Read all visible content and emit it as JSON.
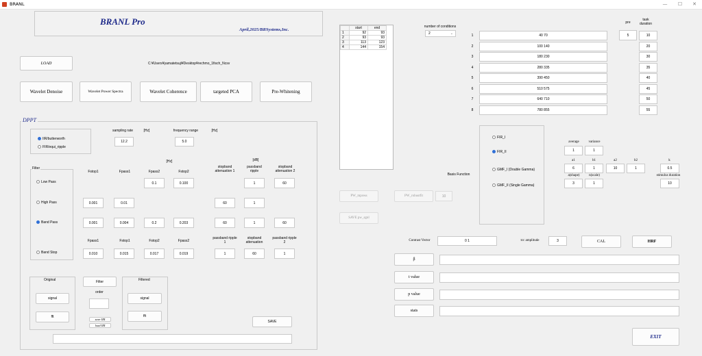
{
  "window": {
    "title": "BRANL",
    "controls": [
      "—",
      "☐",
      "✕"
    ]
  },
  "header": {
    "app_title": "BRANL Pro",
    "subtitle": "April,2025/BRSystems,Inc."
  },
  "load": {
    "label": "LOAD",
    "path": "C:¥Users¥yamatetsuji¥Desktop¥rechmo_1fisch_Ncsv"
  },
  "tools": [
    "Wavelet Denoise",
    "Wavelet Power Spectra",
    "Wavelet Coherence",
    "targeted PCA",
    "Pre-Whitening"
  ],
  "dppt": {
    "title": "DPPT",
    "filter_types": [
      "IIR/butterworth",
      "FIR/equi_ripple"
    ],
    "sampling_rate": {
      "label": "sampling rate",
      "value": "12.2",
      "unit": "[Hz]"
    },
    "frequency_range": {
      "label": "frequency range",
      "value": "5.0",
      "unit": "[Hz]"
    },
    "filter_group_label": "Filter",
    "filter_modes": [
      "Low Pass",
      "High Pass",
      "Band Pass",
      "Band Stop"
    ],
    "hz_unit": "[Hz]",
    "db_unit": "[dB]",
    "hdr1": [
      "Fstop1",
      "Fpass1",
      "Fpass2",
      "Fstop2",
      "stopband attenuation 1",
      "passband ripple",
      "stopband attenuation 2"
    ],
    "row_low": [
      "0.1",
      "0.100",
      "1",
      "60"
    ],
    "row_high": [
      "0.001",
      "0.01",
      "60",
      "1"
    ],
    "row_band": [
      "0.001",
      "0.004",
      "0.2",
      "0.203",
      "60",
      "1",
      "60"
    ],
    "hdr2": [
      "Fpass1",
      "Fstop1",
      "Fstop2",
      "Fpass2",
      "passband ripple 1",
      "stopband attenuation",
      "passband ripple 2"
    ],
    "row_stop": [
      "0.010",
      "0.015",
      "0.017",
      "0.019",
      "1",
      "60",
      "1"
    ],
    "original": {
      "label": "Original",
      "signal": "signal",
      "fft": "fft"
    },
    "filter_btn": "Filter",
    "order_label": "order",
    "order_value": "",
    "save_iir": "save IIR",
    "load_iir": "load IIR",
    "filtered": {
      "label": "Filtered",
      "signal": "signal",
      "fft": "fft"
    },
    "save": "SAVE",
    "status": ""
  },
  "intervals": {
    "headers": [
      "",
      "start",
      "end"
    ],
    "rows": [
      [
        "1",
        "92",
        "93"
      ],
      [
        "2",
        "93",
        "93"
      ],
      [
        "3",
        "113",
        "123"
      ],
      [
        "4",
        "144",
        "154"
      ]
    ]
  },
  "conditions": {
    "label": "number of conditions",
    "value": "2"
  },
  "cond_table": {
    "header_pre": "pre",
    "header_task": "task duration",
    "pre_value": "5",
    "rows": [
      {
        "n": "1",
        "onsets": "40 70",
        "task": "10"
      },
      {
        "n": "2",
        "onsets": "100 140",
        "task": "20"
      },
      {
        "n": "3",
        "onsets": "180 230",
        "task": "30"
      },
      {
        "n": "4",
        "onsets": "280 335",
        "task": "35"
      },
      {
        "n": "5",
        "onsets": "390 450",
        "task": "40"
      },
      {
        "n": "6",
        "onsets": "510 575",
        "task": "45"
      },
      {
        "n": "7",
        "onsets": "640 710",
        "task": "50"
      },
      {
        "n": "8",
        "onsets": "780 855",
        "task": "55"
      }
    ]
  },
  "basis": {
    "label": "Basis Function",
    "options": [
      "FIR_I",
      "FIR_II",
      "GMF_I (Double Gamma)",
      "GMF_II (Single Gamma)"
    ],
    "selected": 1
  },
  "params": {
    "average": {
      "label": "average",
      "value": "1"
    },
    "variance": {
      "label": "variance",
      "value": "1"
    },
    "a1": {
      "label": "a1",
      "value": "6"
    },
    "b1": {
      "label": "b1",
      "value": "1"
    },
    "a2": {
      "label": "a2",
      "value": "10"
    },
    "b2": {
      "label": "b2",
      "value": "1"
    },
    "k": {
      "label": "k",
      "value": "0.5"
    },
    "a_shape": {
      "label": "a(shape)",
      "value": "3"
    },
    "n_scale": {
      "label": "n(scale)",
      "value": "1"
    },
    "stim_duration": {
      "label": "stimulus duration",
      "value": "10"
    }
  },
  "pw": {
    "mpress": "PW_mpress",
    "robust": "PW_robustfit",
    "robust_value": "10",
    "save": "SAVE pw_sgnl"
  },
  "contrast": {
    "label": "Contrast Vector",
    "value": "0 1",
    "tcc_label": "tcc amplitude",
    "tcc_value": "3",
    "cal": "CAL",
    "hrf": "HRF"
  },
  "stats": [
    "β",
    "t value",
    "p value",
    "stats"
  ],
  "exit": "EXIT"
}
